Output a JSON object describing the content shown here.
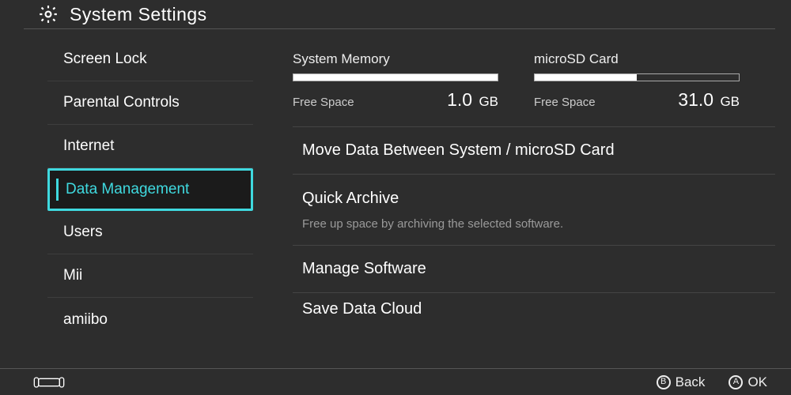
{
  "header": {
    "title": "System Settings"
  },
  "sidebar": {
    "items": [
      {
        "label": "Screen Lock"
      },
      {
        "label": "Parental Controls"
      },
      {
        "label": "Internet"
      },
      {
        "label": "Data Management"
      },
      {
        "label": "Users"
      },
      {
        "label": "Mii"
      },
      {
        "label": "amiibo"
      }
    ],
    "selected_index": 3
  },
  "storage": {
    "system": {
      "label": "System Memory",
      "free_label": "Free Space",
      "free_value": "1.0",
      "free_unit": "GB",
      "fill_pct": 97
    },
    "sd": {
      "label": "microSD Card",
      "free_label": "Free Space",
      "free_value": "31.0",
      "free_unit": "GB",
      "fill_pct": 50
    }
  },
  "menu": {
    "move": {
      "title": "Move Data Between System / microSD Card"
    },
    "archive": {
      "title": "Quick Archive",
      "sub": "Free up space by archiving the selected software."
    },
    "manage": {
      "title": "Manage Software"
    },
    "cloud": {
      "title": "Save Data Cloud"
    }
  },
  "footer": {
    "back": {
      "glyph": "B",
      "label": "Back"
    },
    "ok": {
      "glyph": "A",
      "label": "OK"
    }
  }
}
